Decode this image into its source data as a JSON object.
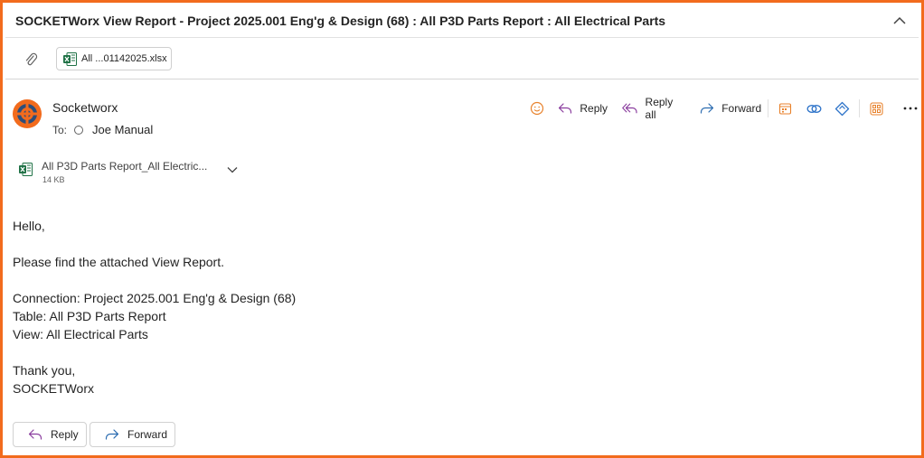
{
  "header": {
    "subject": "SOCKETWorx View Report - Project 2025.001 Eng'g & Design (68) : All P3D Parts Report : All Electrical Parts"
  },
  "attachment_bar": {
    "file_label": "All ...01142025.xlsx"
  },
  "message": {
    "sender": "Socketworx",
    "to_label": "To:",
    "recipient": "Joe Manual"
  },
  "toolbar": {
    "reply": "Reply",
    "reply_all": "Reply all",
    "forward": "Forward"
  },
  "attachment": {
    "name": "All P3D Parts Report_All Electric...",
    "size": "14 KB"
  },
  "body": {
    "greeting": "Hello,",
    "line1": "Please find the attached View Report.",
    "connection": "Connection: Project 2025.001 Eng'g & Design (68)",
    "table": "Table: All P3D Parts Report",
    "view": "View: All Electrical Parts",
    "thanks": "Thank you,",
    "signature": "SOCKETWorx"
  },
  "footer": {
    "reply": "Reply",
    "forward": "Forward"
  },
  "colors": {
    "frame": "#f26b1d",
    "reply_arrow": "#8a3d9e",
    "forward_arrow": "#2b6cb0",
    "excel_green": "#1e7145",
    "icon_orange": "#e8822c",
    "icon_blue": "#2f74c9"
  },
  "icons": {
    "collapse": "chevron-up-icon",
    "paperclip": "paperclip-icon",
    "excel": "excel-file-icon",
    "avatar": "socketworx-logo",
    "emoji": "smiley-icon",
    "reply": "reply-arrow-icon",
    "reply_all": "reply-all-arrow-icon",
    "forward": "forward-arrow-icon",
    "more": "more-icon"
  }
}
